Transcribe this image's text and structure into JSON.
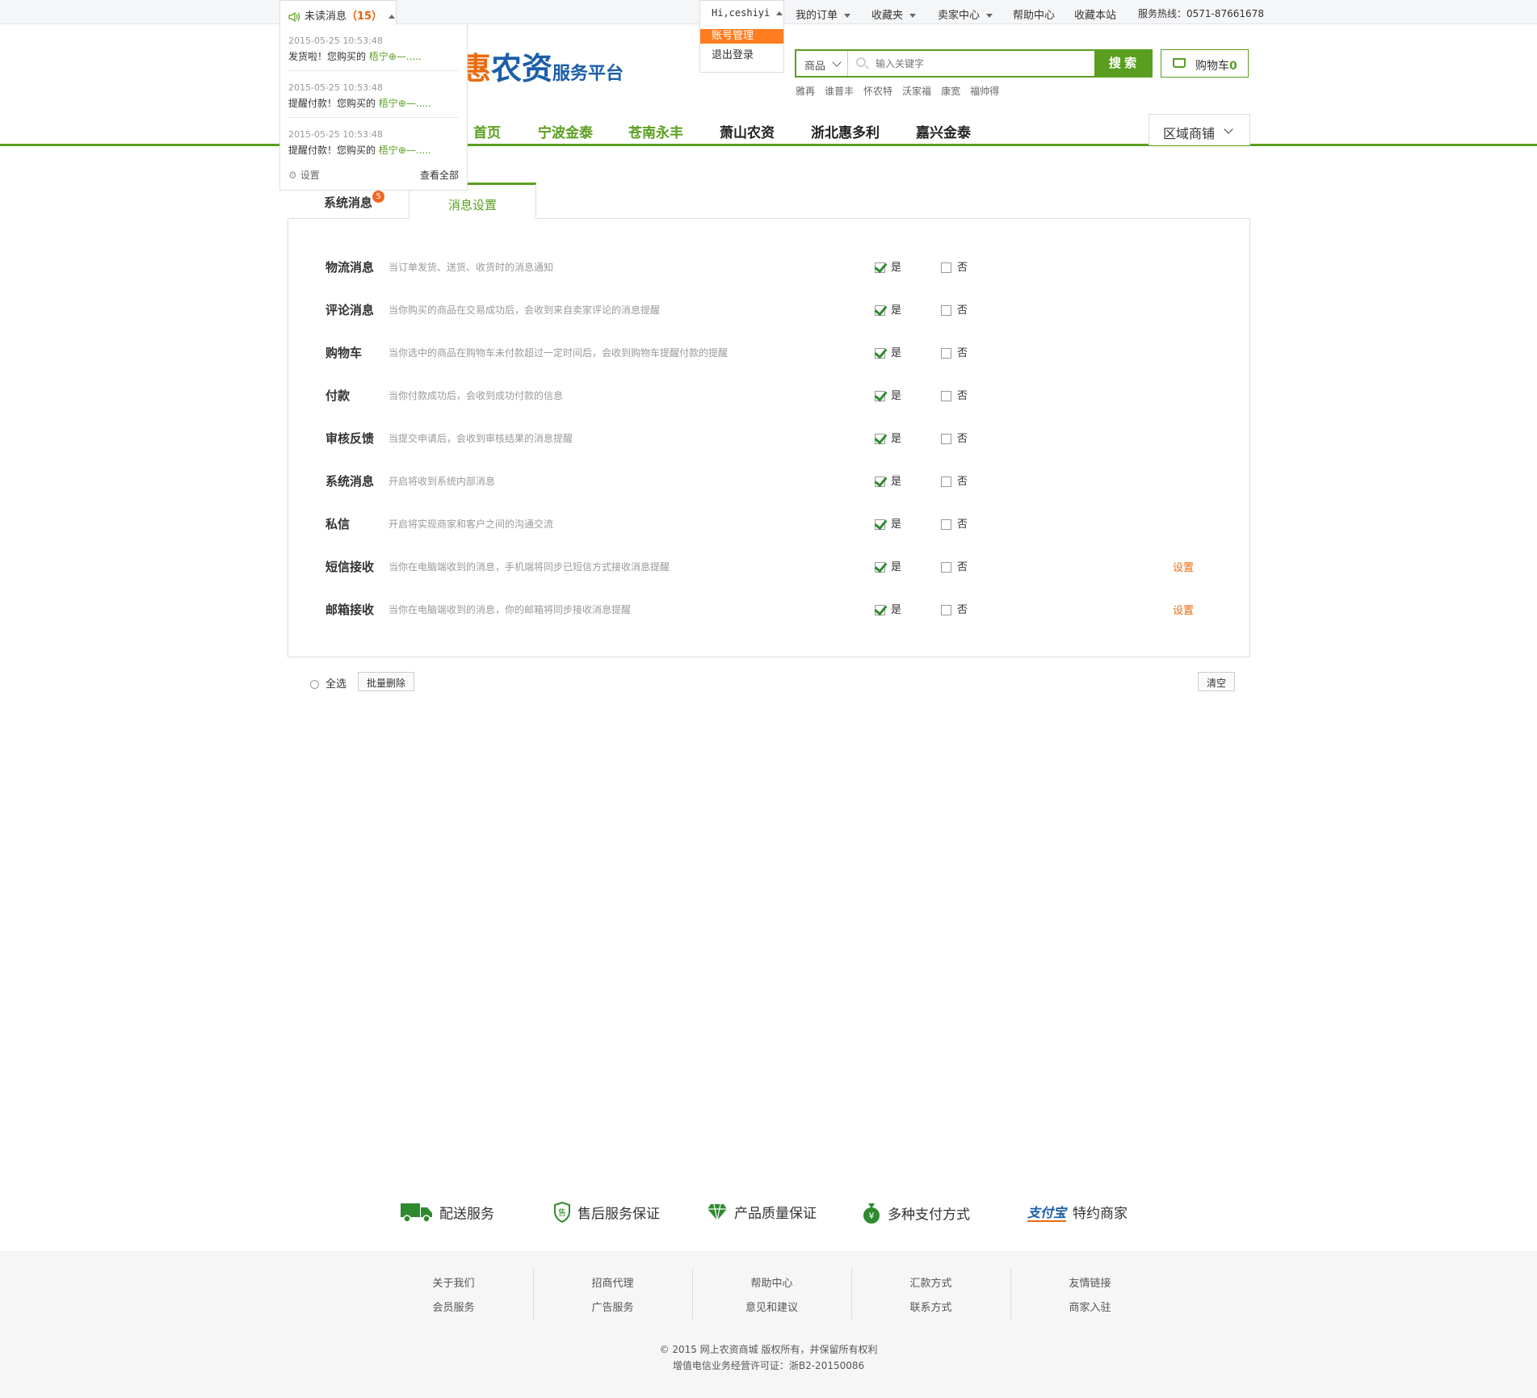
{
  "topbar": {
    "unread_label": "未读消息",
    "unread_count": "（15）",
    "user_greeting": "Hi,ceshiyi",
    "my_orders": "我的订单",
    "favorites": "收藏夹",
    "seller_center": "卖家中心",
    "help_center": "帮助中心",
    "bookmark": "收藏本站",
    "hotline": "服务热线：0571-87661678"
  },
  "messages": [
    {
      "time": "2015-05-25 10:53:48",
      "text": "发货啦！您购买的 ",
      "highlight": "梧宁⊕—....."
    },
    {
      "time": "2015-05-25 10:53:48",
      "text": "提醒付款！您购买的 ",
      "highlight": "梧宁⊕—....."
    },
    {
      "time": "2015-05-25 10:53:48",
      "text": "提醒付款！您购买的 ",
      "highlight": "梧宁⊕—....."
    }
  ],
  "msg_footer": {
    "settings": "设置",
    "view_all": "查看全部"
  },
  "user_menu": {
    "account": "账号管理",
    "logout": "退出登录"
  },
  "logo": {
    "part1": "惠",
    "part2": "农资",
    "part3": "服务平台"
  },
  "search": {
    "category": "商品",
    "placeholder": "输入关键字",
    "button": "搜 索"
  },
  "cart": {
    "label": "购物车",
    "count": "0"
  },
  "hotwords": [
    "雅再",
    "谁普丰",
    "怀农特",
    "沃家福",
    "康宽",
    "福帅得"
  ],
  "nav": [
    "首页",
    "宁波金泰",
    "苍南永丰",
    "萧山农资",
    "浙北惠多利",
    "嘉兴金泰"
  ],
  "region": "区域商铺",
  "tabs": {
    "system": "系统消息",
    "system_badge": "5",
    "settings": "消息设置"
  },
  "settings_rows": [
    {
      "label": "物流消息",
      "desc": "当订单发货、送货、收货时的消息通知",
      "yes": "是",
      "no": "否",
      "set": ""
    },
    {
      "label": "评论消息",
      "desc": "当你购买的商品在交易成功后，会收到来自卖家评论的消息提醒",
      "yes": "是",
      "no": "否",
      "set": ""
    },
    {
      "label": "购物车",
      "desc": "当你选中的商品在购物车未付款超过一定时间后，会收到购物车提醒付款的提醒",
      "yes": "是",
      "no": "否",
      "set": ""
    },
    {
      "label": "付款",
      "desc": "当你付款成功后，会收到成功付款的信息",
      "yes": "是",
      "no": "否",
      "set": ""
    },
    {
      "label": "审核反馈",
      "desc": "当提交申请后，会收到审核结果的消息提醒",
      "yes": "是",
      "no": "否",
      "set": ""
    },
    {
      "label": "系统消息",
      "desc": "开启将收到系统内部消息",
      "yes": "是",
      "no": "否",
      "set": ""
    },
    {
      "label": "私信",
      "desc": "开启将实现商家和客户之间的沟通交流",
      "yes": "是",
      "no": "否",
      "set": ""
    },
    {
      "label": "短信接收",
      "desc": "当你在电脑端收到的消息，手机端将同步已短信方式接收消息提醒",
      "yes": "是",
      "no": "否",
      "set": "设置"
    },
    {
      "label": "邮箱接收",
      "desc": "当你在电脑端收到的消息，你的邮箱将同步接收消息提醒",
      "yes": "是",
      "no": "否",
      "set": "设置"
    }
  ],
  "bottom": {
    "select_all": "全选",
    "batch_delete": "批量删除",
    "clear": "清空"
  },
  "features": [
    {
      "icon": "truck-icon",
      "label": "配送服务"
    },
    {
      "icon": "shield-icon",
      "label": "售后服务保证"
    },
    {
      "icon": "diamond-icon",
      "label": "产品质量保证"
    },
    {
      "icon": "money-bag-icon",
      "label": "多种支付方式"
    },
    {
      "icon": "alipay-logo",
      "label": "特约商家"
    }
  ],
  "footer_cols": [
    [
      "关于我们",
      "会员服务"
    ],
    [
      "招商代理",
      "广告服务"
    ],
    [
      "帮助中心",
      "意见和建议"
    ],
    [
      "汇款方式",
      "联系方式"
    ],
    [
      "友情链接",
      "商家入驻"
    ]
  ],
  "copyright": {
    "line1": "© 2015 网上农资商城 版权所有，并保留所有权利",
    "line2": "增值电信业务经营许可证：浙B2-20150086"
  },
  "colors": {
    "green": "#5a9e1f",
    "orange": "#ea6b11",
    "blue": "#1d5ea8"
  }
}
